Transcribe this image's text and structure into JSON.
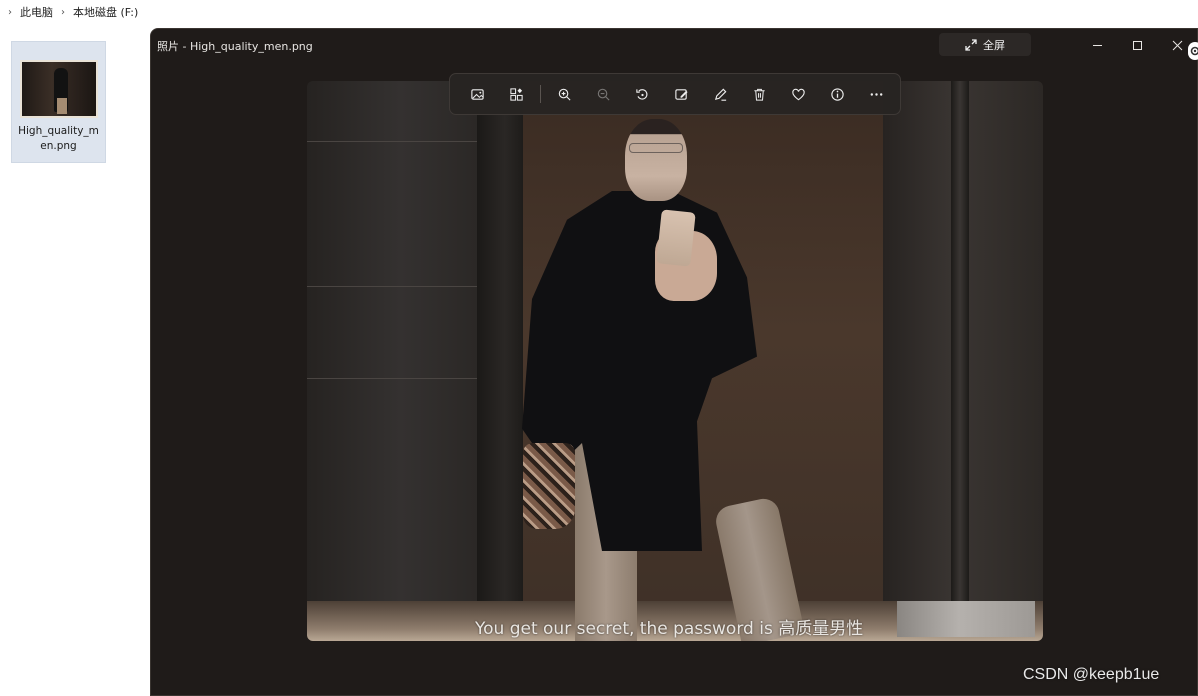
{
  "explorer": {
    "breadcrumbs": [
      "此电脑",
      "本地磁盘 (F:)"
    ],
    "file": {
      "name": "High_quality_men.png"
    }
  },
  "photos": {
    "title": "照片 - High_quality_men.png",
    "fullscreen_label": "全屏",
    "toolbar": {
      "items": [
        "view-image-icon",
        "collection-icon",
        "zoom-in-icon",
        "zoom-out-icon",
        "rotate-icon",
        "edit-icon",
        "draw-icon",
        "delete-icon",
        "favorite-icon",
        "info-icon",
        "more-icon"
      ]
    },
    "image": {
      "subtitle": "You get our secret, the password is 高质量男性"
    }
  },
  "watermark": "CSDN @keepb1ue",
  "colors": {
    "window_bg": "#1f1b19",
    "toolbar_bg": "#282422",
    "explorer_selected": "#dde4ee"
  }
}
